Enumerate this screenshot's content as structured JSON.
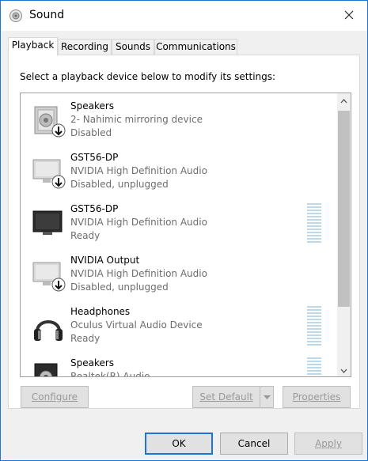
{
  "window": {
    "title": "Sound"
  },
  "tabs": [
    {
      "label": "Playback"
    },
    {
      "label": "Recording"
    },
    {
      "label": "Sounds"
    },
    {
      "label": "Communications"
    }
  ],
  "instruction": "Select a playback device below to modify its settings:",
  "devices": [
    {
      "name": "Speakers",
      "description": "2- Nahimic mirroring device",
      "status": "Disabled",
      "icon": "speaker-icon"
    },
    {
      "name": "GST56-DP",
      "description": "NVIDIA High Definition Audio",
      "status": "Disabled, unplugged",
      "icon": "monitor-icon"
    },
    {
      "name": "GST56-DP",
      "description": "NVIDIA High Definition Audio",
      "status": "Ready",
      "icon": "monitor-icon"
    },
    {
      "name": "NVIDIA Output",
      "description": "NVIDIA High Definition Audio",
      "status": "Disabled, unplugged",
      "icon": "monitor-icon"
    },
    {
      "name": "Headphones",
      "description": "Oculus Virtual Audio Device",
      "status": "Ready",
      "icon": "headphones-icon"
    },
    {
      "name": "Speakers",
      "description": "Realtek(R) Audio",
      "status": "",
      "icon": "speaker-icon"
    }
  ],
  "buttons": {
    "configure": "Configure",
    "set_default": "Set Default",
    "properties": "Properties",
    "ok": "OK",
    "cancel": "Cancel",
    "apply": "Apply"
  },
  "colors": {
    "accent": "#1f74d1",
    "disabled_text": "#999999",
    "meter": "#bcd9e9"
  }
}
